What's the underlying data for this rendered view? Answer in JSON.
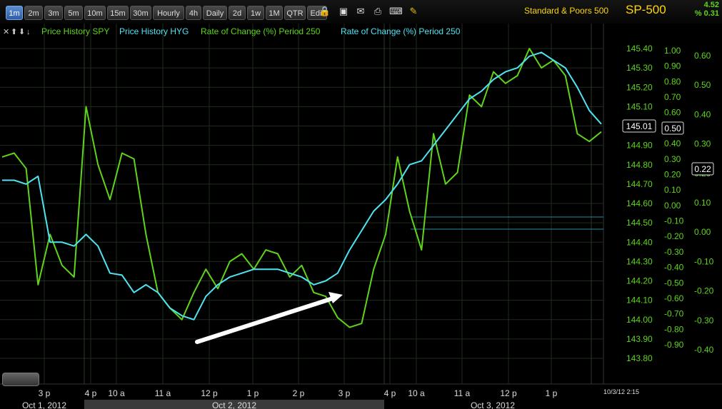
{
  "toolbar": {
    "buttons": [
      "1m",
      "2m",
      "3m",
      "5m",
      "10m",
      "15m",
      "30m",
      "Hourly",
      "4h",
      "Daily",
      "2d",
      "1w",
      "1M",
      "QTR",
      "Edit"
    ],
    "active": "1m",
    "icons": [
      "lock-icon",
      "save-icon",
      "email-icon",
      "print-icon",
      "keyboard-icon",
      "pencil-icon"
    ]
  },
  "symbol": {
    "name": "Standard & Poors 500",
    "ticker": "SP-500",
    "change": "4.52",
    "change_pct": "% 0.31"
  },
  "legend": {
    "icons": [
      "close-icon",
      "arrow-up-icon",
      "arrow-down-icon",
      "pin-icon"
    ],
    "items": [
      {
        "label": "Price History SPY",
        "color": "#5fd41a"
      },
      {
        "label": "Price History HYG",
        "color": "#4fe3f2"
      },
      {
        "label": "Rate of Change (%) Period 250",
        "color": "#5fd41a"
      },
      {
        "label": "Rate of Change (%) Period 250",
        "color": "#4fe3f2"
      }
    ]
  },
  "colors": {
    "spy": "#5fd41a",
    "hyg": "#4fe3f2",
    "grid": "#1d2b1d",
    "arrow": "#ffffff"
  },
  "chart_data": {
    "type": "line",
    "x_ticks": [
      "3 p",
      "4 p",
      "10 a",
      "11 a",
      "12 p",
      "1 p",
      "2 p",
      "3 p",
      "4 p",
      "10 a",
      "11 a",
      "12 p",
      "1 p"
    ],
    "date_labels": [
      "Oct 1, 2012",
      "Oct 2, 2012",
      "Oct 3, 2012"
    ],
    "timestamp": "10/3/12 2:15",
    "axes": [
      {
        "id": "price",
        "ticks": [
          "145.40",
          "145.30",
          "145.20",
          "145.10",
          "145.00",
          "144.90",
          "144.80",
          "144.70",
          "144.60",
          "144.50",
          "144.40",
          "144.30",
          "144.20",
          "144.10",
          "144.00",
          "143.90",
          "143.80"
        ],
        "ylim": [
          143.8,
          145.4
        ],
        "last": "145.01"
      },
      {
        "id": "roc_hyg",
        "ticks": [
          "1.00",
          "0.90",
          "0.80",
          "0.70",
          "0.60",
          "0.50",
          "0.40",
          "0.30",
          "0.20",
          "0.10",
          "0.00",
          "-0.10",
          "-0.20",
          "-0.30",
          "-0.40",
          "-0.50",
          "-0.60",
          "-0.70",
          "-0.80",
          "-0.90"
        ],
        "ylim": [
          -0.9,
          1.0
        ],
        "last": "0.50"
      },
      {
        "id": "roc_spy",
        "ticks": [
          "0.60",
          "0.50",
          "0.40",
          "0.30",
          "0.20",
          "0.10",
          "0.00",
          "-0.10",
          "-0.20",
          "-0.30",
          "-0.40"
        ],
        "ylim": [
          -0.4,
          0.6
        ],
        "last": "0.22"
      }
    ],
    "series": [
      {
        "name": "Price History SPY",
        "x": [
          0,
          2,
          4,
          6,
          8,
          10,
          12,
          14,
          16,
          18,
          20,
          22,
          24,
          26,
          28,
          30,
          32,
          34,
          36,
          38,
          40,
          42,
          44,
          46,
          48,
          50,
          52,
          54,
          56,
          58,
          60,
          62,
          64,
          66,
          68,
          70,
          72,
          74,
          76,
          78,
          80,
          82,
          84,
          86,
          88,
          90,
          92,
          94,
          96,
          98,
          100
        ],
        "y": [
          144.84,
          144.86,
          144.78,
          144.18,
          144.44,
          144.28,
          144.22,
          145.1,
          144.8,
          144.62,
          144.86,
          144.83,
          144.44,
          144.14,
          144.06,
          144.0,
          144.14,
          144.26,
          144.16,
          144.3,
          144.34,
          144.26,
          144.36,
          144.34,
          144.22,
          144.28,
          144.14,
          144.12,
          144.01,
          143.96,
          143.98,
          144.26,
          144.44,
          144.84,
          144.56,
          144.36,
          144.96,
          144.7,
          144.76,
          145.16,
          145.1,
          145.28,
          145.22,
          145.26,
          145.4,
          145.3,
          145.34,
          145.26,
          144.96,
          144.92,
          144.97
        ]
      },
      {
        "name": "Price History HYG",
        "x": [
          0,
          2,
          4,
          6,
          8,
          10,
          12,
          14,
          16,
          18,
          20,
          22,
          24,
          26,
          28,
          30,
          32,
          34,
          36,
          38,
          40,
          42,
          44,
          46,
          48,
          50,
          52,
          54,
          56,
          58,
          60,
          62,
          64,
          66,
          68,
          70,
          72,
          74,
          76,
          78,
          80,
          82,
          84,
          86,
          88,
          90,
          92,
          94,
          96,
          98,
          100
        ],
        "y": [
          144.72,
          144.72,
          144.7,
          144.74,
          144.4,
          144.4,
          144.38,
          144.44,
          144.38,
          144.24,
          144.23,
          144.14,
          144.18,
          144.14,
          144.06,
          144.02,
          144.0,
          144.12,
          144.18,
          144.22,
          144.24,
          144.26,
          144.26,
          144.26,
          144.24,
          144.22,
          144.18,
          144.2,
          144.24,
          144.36,
          144.46,
          144.56,
          144.62,
          144.7,
          144.8,
          144.82,
          144.9,
          144.98,
          145.06,
          145.14,
          145.18,
          145.24,
          145.28,
          145.3,
          145.36,
          145.38,
          145.34,
          145.3,
          145.2,
          145.08,
          145.01
        ]
      }
    ],
    "grid": true,
    "legend_position": "top-left"
  }
}
